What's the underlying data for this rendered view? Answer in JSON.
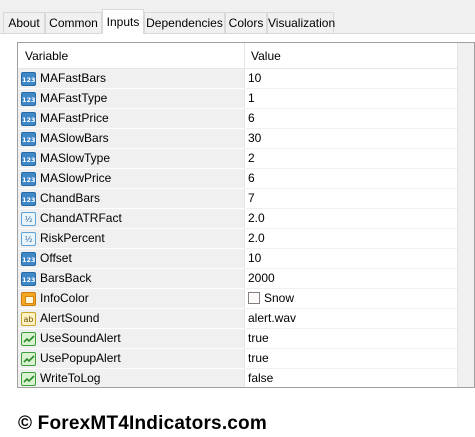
{
  "tabs": [
    {
      "label": "About"
    },
    {
      "label": "Common"
    },
    {
      "label": "Inputs",
      "active": true
    },
    {
      "label": "Dependencies"
    },
    {
      "label": "Colors"
    },
    {
      "label": "Visualization"
    }
  ],
  "table": {
    "headers": {
      "variable": "Variable",
      "value": "Value"
    },
    "rows": [
      {
        "type": "int",
        "name": "MAFastBars",
        "value": "10"
      },
      {
        "type": "int",
        "name": "MAFastType",
        "value": "1"
      },
      {
        "type": "int",
        "name": "MAFastPrice",
        "value": "6"
      },
      {
        "type": "int",
        "name": "MASlowBars",
        "value": "30"
      },
      {
        "type": "int",
        "name": "MASlowType",
        "value": "2"
      },
      {
        "type": "int",
        "name": "MASlowPrice",
        "value": "6"
      },
      {
        "type": "int",
        "name": "ChandBars",
        "value": "7"
      },
      {
        "type": "double",
        "name": "ChandATRFact",
        "value": "2.0"
      },
      {
        "type": "double",
        "name": "RiskPercent",
        "value": "2.0"
      },
      {
        "type": "int",
        "name": "Offset",
        "value": "10"
      },
      {
        "type": "int",
        "name": "BarsBack",
        "value": "2000"
      },
      {
        "type": "color",
        "name": "InfoColor",
        "value": "Snow",
        "swatch": "#fffafa"
      },
      {
        "type": "string",
        "name": "AlertSound",
        "value": "alert.wav"
      },
      {
        "type": "bool",
        "name": "UseSoundAlert",
        "value": "true"
      },
      {
        "type": "bool",
        "name": "UsePopupAlert",
        "value": "true"
      },
      {
        "type": "bool",
        "name": "WriteToLog",
        "value": "false"
      }
    ]
  },
  "icon_glyphs": {
    "int": "123",
    "double": "½",
    "string": "ab"
  },
  "watermark": "© ForexMT4Indicators.com"
}
